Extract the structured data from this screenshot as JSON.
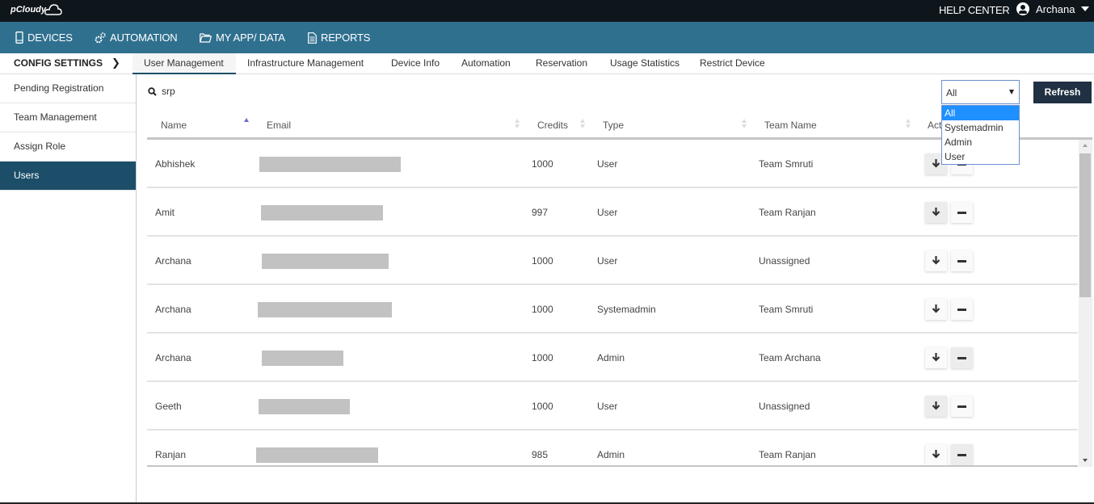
{
  "brand": {
    "logo_text": "pCloudy"
  },
  "topbar": {
    "help_label": "HELP CENTER",
    "user_name": "Archana"
  },
  "nav": {
    "items": [
      {
        "label": "DEVICES",
        "icon": "mobile-icon"
      },
      {
        "label": "AUTOMATION",
        "icon": "gears-icon"
      },
      {
        "label": "MY APP/ DATA",
        "icon": "folder-icon"
      },
      {
        "label": "REPORTS",
        "icon": "document-icon"
      }
    ]
  },
  "subnav": {
    "section_label": "CONFIG SETTINGS",
    "tabs": [
      {
        "label": "User Management",
        "active": true
      },
      {
        "label": "Infrastructure Management"
      },
      {
        "label": "Device Info"
      },
      {
        "label": "Automation"
      },
      {
        "label": "Reservation"
      },
      {
        "label": "Usage Statistics"
      },
      {
        "label": "Restrict Device"
      }
    ]
  },
  "sidebar": {
    "items": [
      {
        "label": "Pending Registration"
      },
      {
        "label": "Team Management"
      },
      {
        "label": "Assign Role"
      },
      {
        "label": "Users",
        "active": true
      }
    ]
  },
  "search": {
    "value": "srp"
  },
  "filter": {
    "selected": "All",
    "options": [
      "All",
      "Systemadmin",
      "Admin",
      "User"
    ],
    "highlighted": "All"
  },
  "refresh_label": "Refresh",
  "table": {
    "columns": [
      "Name",
      "Email",
      "Credits",
      "Type",
      "Team Name",
      "Action"
    ],
    "sorted_column": "Name",
    "sort_direction": "ascending",
    "rows": [
      {
        "name": "Abhishek",
        "email": "[redacted]",
        "credits": "1000",
        "type": "User",
        "team": "Team Smruti"
      },
      {
        "name": "Amit",
        "email": "[redacted]",
        "credits": "997",
        "type": "User",
        "team": "Team Ranjan"
      },
      {
        "name": "Archana",
        "email": "[redacted]",
        "credits": "1000",
        "type": "User",
        "team": "Unassigned"
      },
      {
        "name": "Archana",
        "email": "[redacted]",
        "credits": "1000",
        "type": "Systemadmin",
        "team": "Team Smruti"
      },
      {
        "name": "Archana",
        "email": "[redacted]",
        "credits": "1000",
        "type": "Admin",
        "team": "Team Archana"
      },
      {
        "name": "Geeth",
        "email": "[redacted]",
        "credits": "1000",
        "type": "User",
        "team": "Unassigned"
      },
      {
        "name": "Ranjan",
        "email": "[redacted]",
        "credits": "985",
        "type": "Admin",
        "team": "Team Ranjan"
      }
    ]
  },
  "colors": {
    "topbar": "#0f161b",
    "navbar": "#30708f",
    "sidebar_active": "#1c4e69",
    "refresh_button": "#1f3142",
    "dropdown_highlight": "#1e90ff"
  }
}
